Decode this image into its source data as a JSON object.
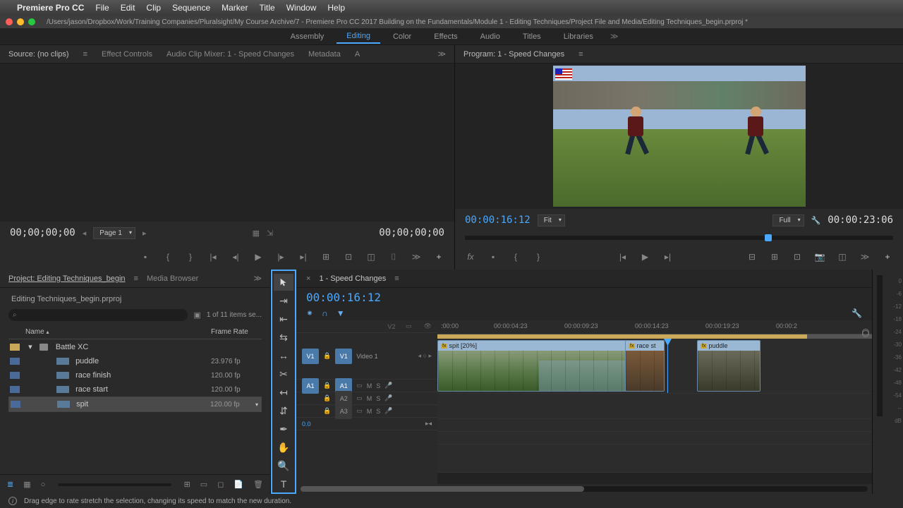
{
  "menubar": {
    "app": "Premiere Pro CC",
    "items": [
      "File",
      "Edit",
      "Clip",
      "Sequence",
      "Marker",
      "Title",
      "Window",
      "Help"
    ]
  },
  "titlebar": {
    "path": "/Users/jason/Dropbox/Work/Training Companies/Pluralsight/My Course Archive/7 - Premiere Pro CC 2017 Building on the Fundamentals/Module 1 - Editing Techniques/Project File and Media/Editing Techniques_begin.prproj *"
  },
  "workspace": {
    "tabs": [
      "Assembly",
      "Editing",
      "Color",
      "Effects",
      "Audio",
      "Titles",
      "Libraries"
    ],
    "active": "Editing"
  },
  "source": {
    "tabs": {
      "src": "Source: (no clips)",
      "fx": "Effect Controls",
      "mixer": "Audio Clip Mixer: 1 - Speed Changes",
      "meta": "Metadata",
      "a": "A"
    },
    "tc_left": "00;00;00;00",
    "page": "Page 1",
    "tc_right": "00;00;00;00"
  },
  "program": {
    "title": "Program: 1 - Speed Changes",
    "tc_left": "00:00:16:12",
    "fit": "Fit",
    "full": "Full",
    "tc_right": "00:00:23:06"
  },
  "project": {
    "tab1": "Project: Editing Techniques_begin",
    "tab2": "Media Browser",
    "filename": "Editing Techniques_begin.prproj",
    "items_count": "1 of 11 items se...",
    "cols": {
      "name": "Name",
      "rate": "Frame Rate"
    },
    "bin": "Battle XC",
    "rows": [
      {
        "name": "puddle",
        "rate": "23.976 fp"
      },
      {
        "name": "race finish",
        "rate": "120.00 fp"
      },
      {
        "name": "race start",
        "rate": "120.00 fp"
      },
      {
        "name": "spit",
        "rate": "120.00 fp"
      }
    ]
  },
  "timeline": {
    "sequence": "1 - Speed Changes",
    "tc": "00:00:16:12",
    "ruler": [
      ":00:00",
      "00:00:04:23",
      "00:00:09:23",
      "00:00:14:23",
      "00:00:19:23",
      "00:00:2"
    ],
    "tracks": {
      "v1": "V1",
      "video1": "Video 1",
      "a1": "A1",
      "a2": "A2",
      "a3": "A3",
      "v2": "V2",
      "m": "M",
      "s": "S",
      "zero": "0.0"
    },
    "clips": {
      "spit": "spit [20%]",
      "racest": "race st",
      "puddle": "puddle"
    }
  },
  "audio_meter": [
    "0",
    "-6",
    "-12",
    "-18",
    "-24",
    "-30",
    "-36",
    "-42",
    "-48",
    "-54",
    "--",
    "dB"
  ],
  "status": {
    "msg": "Drag edge to rate stretch the selection, changing its speed to match the new duration."
  }
}
